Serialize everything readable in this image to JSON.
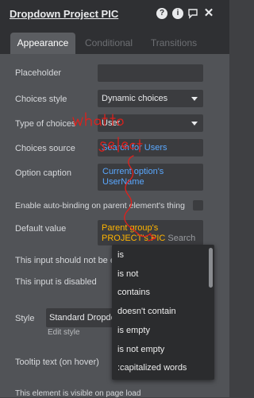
{
  "header": {
    "title": "Dropdown Project PIC"
  },
  "tabs": [
    {
      "label": "Appearance"
    },
    {
      "label": "Conditional"
    },
    {
      "label": "Transitions"
    }
  ],
  "fields": {
    "placeholder_label": "Placeholder",
    "choices_style_label": "Choices style",
    "choices_style_value": "Dynamic choices",
    "type_of_choices_label": "Type of choices",
    "type_of_choices_value": "User",
    "choices_source_label": "Choices source",
    "choices_source_value": "Search for Users",
    "option_caption_label": "Option caption",
    "option_caption_value": "Current option's UserName",
    "auto_binding_label": "Enable auto-binding on parent element's thing",
    "default_value_label": "Default value",
    "default_value_text": "Parent group's PROJECT's PIC",
    "default_value_search": "Search",
    "input_not_empty_label": "This input should not be em",
    "input_disabled_label": "This input is disabled",
    "style_label": "Style",
    "style_value": "Standard Dropdow",
    "edit_style": "Edit style",
    "tooltip_label": "Tooltip text (on hover)",
    "visible_label": "This element is visible on page load"
  },
  "menu": {
    "items": [
      "is",
      "is not",
      "contains",
      "doesn't contain",
      "is empty",
      "is not empty",
      ":capitalized words"
    ]
  },
  "annotation": "what to select",
  "colors": {
    "annotation_red": "#e0201b",
    "link_blue": "#5aa8ff",
    "value_orange": "#ffb400"
  }
}
